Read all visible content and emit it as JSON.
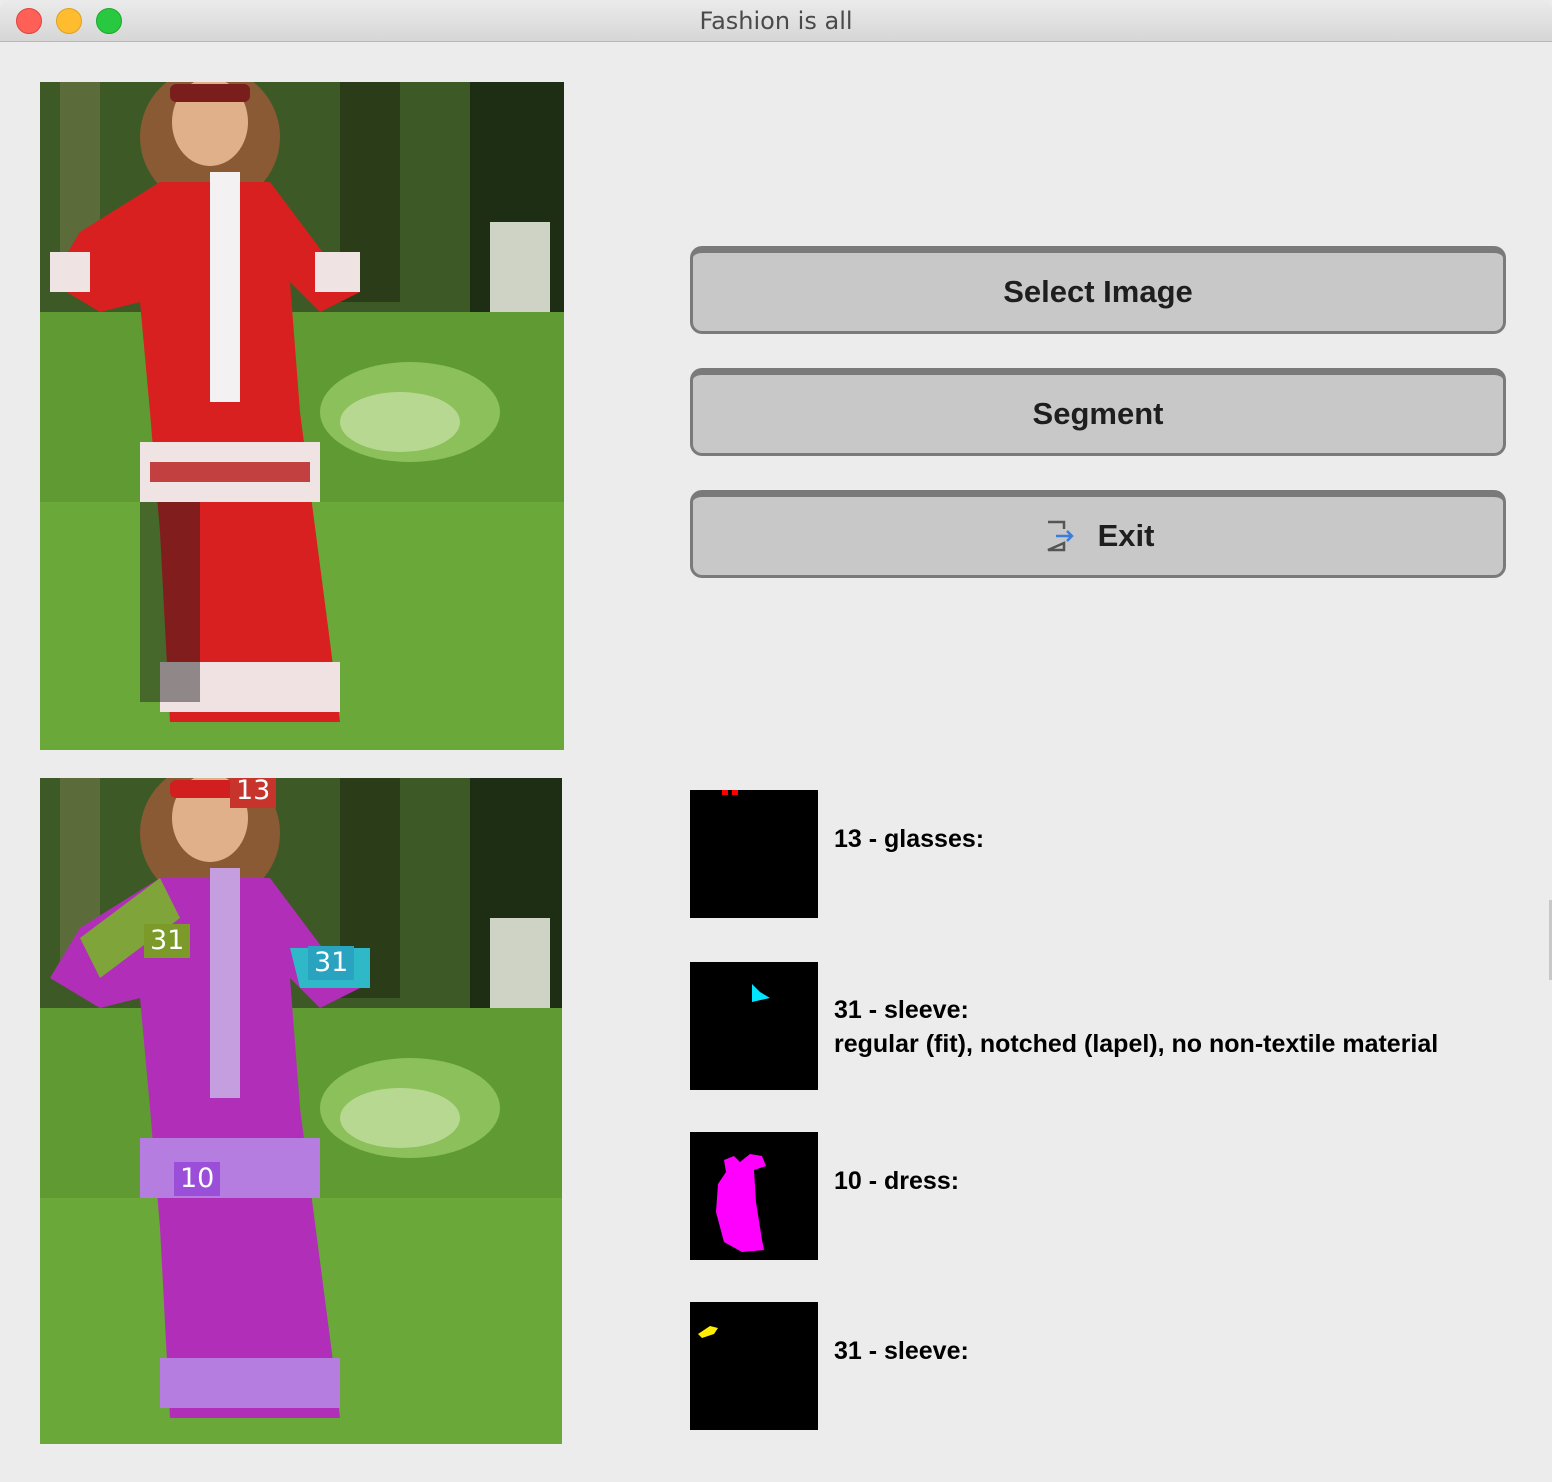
{
  "window": {
    "title": "Fashion is all"
  },
  "buttons": {
    "select_image": "Select Image",
    "segment": "Segment",
    "exit": "Exit"
  },
  "segment_labels": [
    "13",
    "31",
    "31",
    "10"
  ],
  "results": [
    {
      "line1": "13 - glasses:",
      "line2": ""
    },
    {
      "line1": "31 - sleeve:",
      "line2": "regular (fit), notched (lapel), no non-textile material"
    },
    {
      "line1": "10 - dress:",
      "line2": ""
    },
    {
      "line1": "31 - sleeve:",
      "line2": ""
    }
  ],
  "colors": {
    "glasses": "#ff0000",
    "sleeve_right": "#00e5ff",
    "dress": "#ff00ff",
    "sleeve_left": "#ffee00"
  }
}
